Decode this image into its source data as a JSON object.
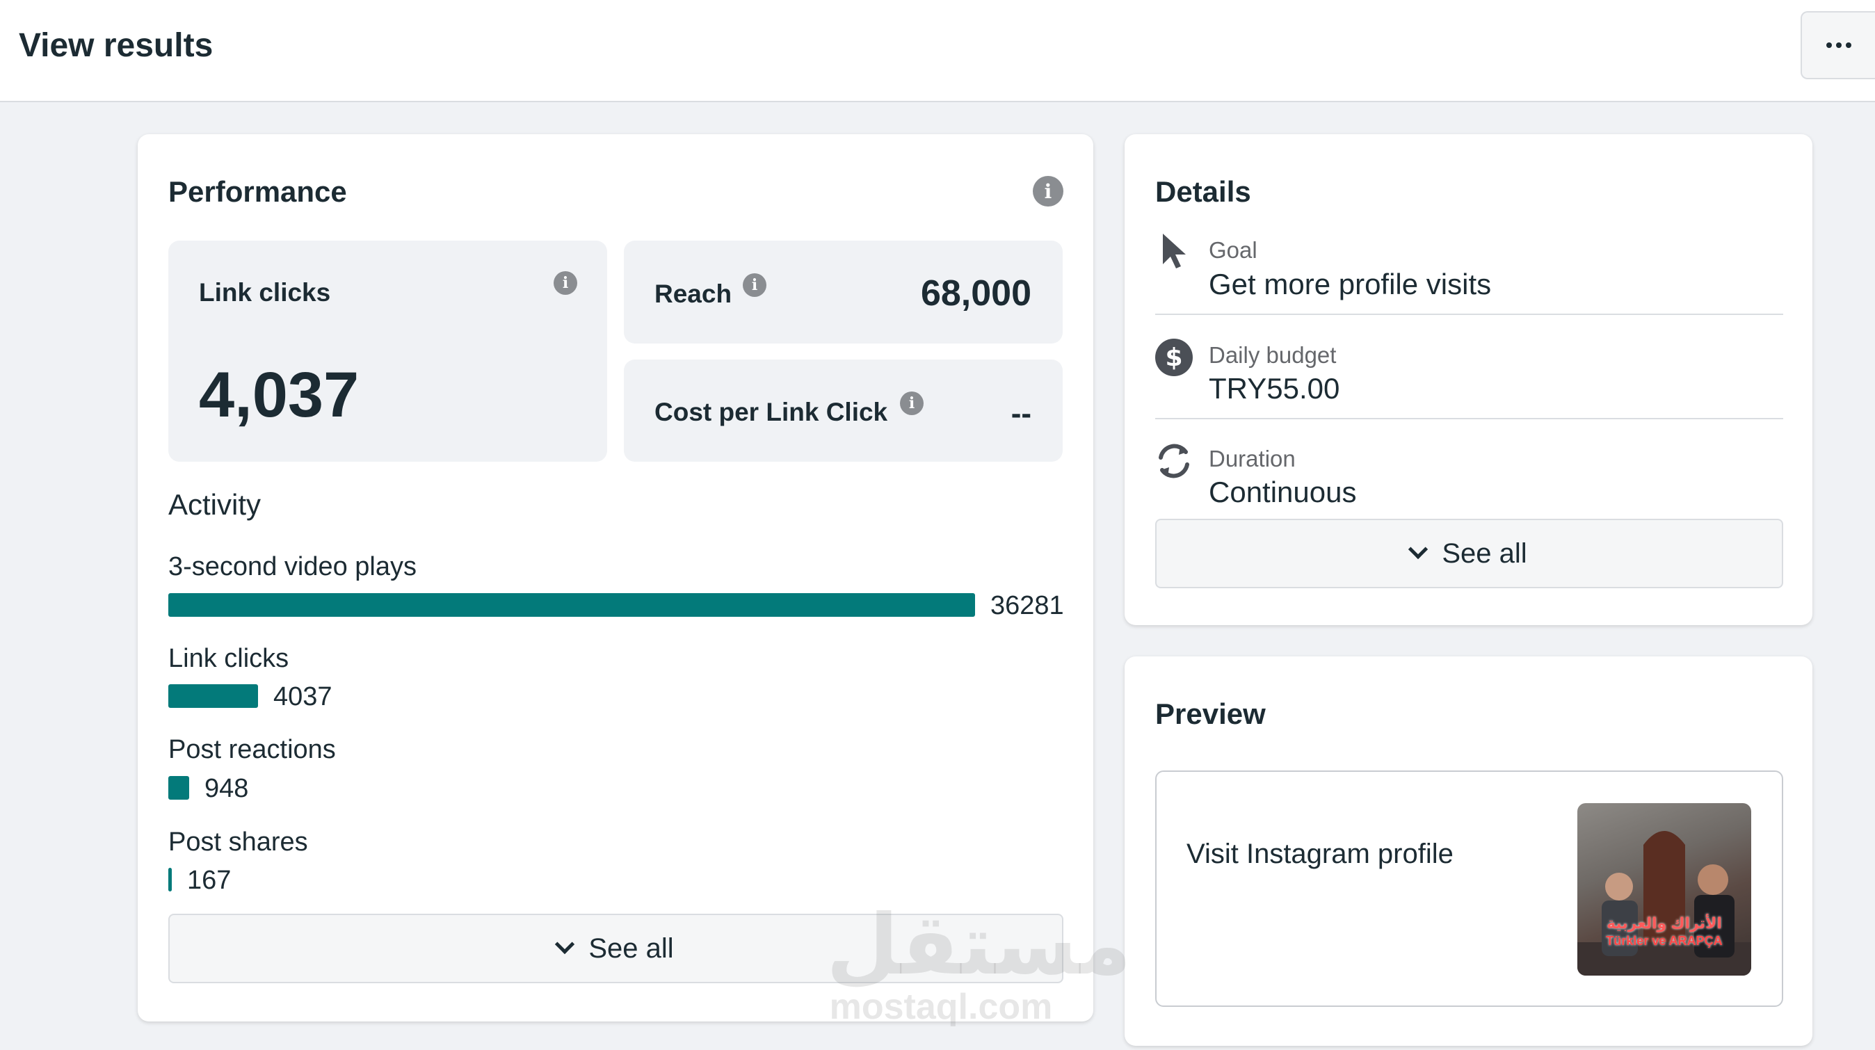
{
  "page": {
    "title": "View results"
  },
  "performance": {
    "title": "Performance",
    "link_clicks": {
      "label": "Link clicks",
      "value": "4,037"
    },
    "reach": {
      "label": "Reach",
      "value": "68,000"
    },
    "cost_per_link_click": {
      "label": "Cost per Link Click",
      "value": "--"
    }
  },
  "activity": {
    "title": "Activity",
    "items": [
      {
        "label": "3-second video plays",
        "value": "36281",
        "fraction": 1.0
      },
      {
        "label": "Link clicks",
        "value": "4037",
        "fraction": 0.111
      },
      {
        "label": "Post reactions",
        "value": "948",
        "fraction": 0.026
      },
      {
        "label": "Post shares",
        "value": "167",
        "fraction": 0.0046
      }
    ],
    "see_all": "See all"
  },
  "details": {
    "title": "Details",
    "goal": {
      "label": "Goal",
      "value": "Get more profile visits"
    },
    "daily_budget": {
      "label": "Daily budget",
      "value": "TRY55.00"
    },
    "duration": {
      "label": "Duration",
      "value": "Continuous"
    },
    "see_all": "See all"
  },
  "preview": {
    "title": "Preview",
    "cta": "Visit Instagram profile",
    "thumbnail_caption": "الأتراك والعربية",
    "thumbnail_caption_2": "Türkler ve ARAPÇA"
  },
  "watermark": {
    "arabic": "مستقل",
    "latin": "mostaql.com"
  },
  "colors": {
    "bar": "#037a7a",
    "background": "#f0f2f5",
    "card": "#ffffff",
    "text": "#1c2b33"
  },
  "icons": [
    "more-icon",
    "info-icon",
    "cursor-icon",
    "dollar-icon",
    "refresh-icon",
    "chevron-down-icon"
  ]
}
